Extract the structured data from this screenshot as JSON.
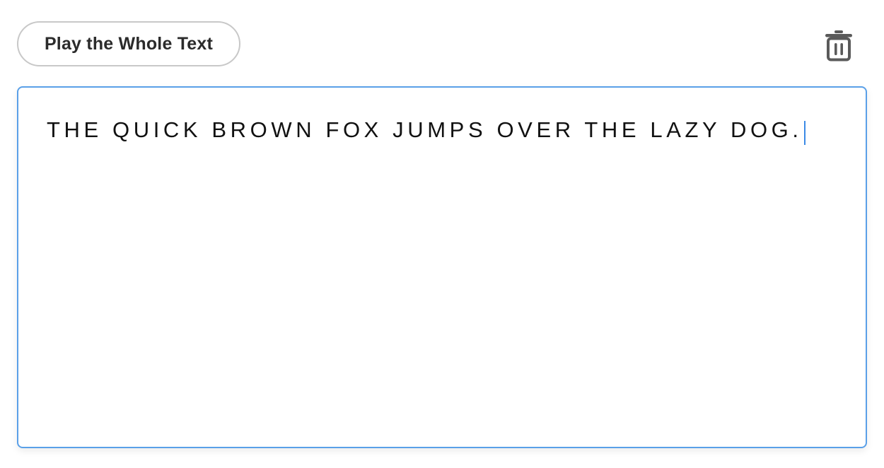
{
  "toolbar": {
    "play_label": "Play the Whole Text",
    "delete_icon": "trash-icon"
  },
  "editor": {
    "text": "THE QUICK BROWN FOX JUMPS OVER THE LAZY DOG."
  },
  "colors": {
    "focus_border": "#5aa0e8",
    "caret": "#3b8ae6",
    "button_border": "#c8c8c8",
    "icon": "#5a5a5a"
  }
}
